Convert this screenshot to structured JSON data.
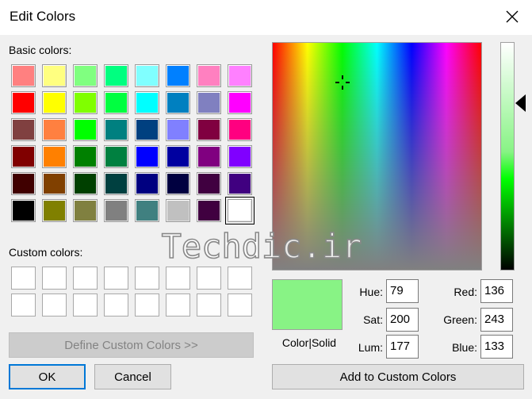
{
  "window": {
    "title": "Edit Colors",
    "close_icon": "close-icon"
  },
  "basic_colors": {
    "label": "Basic colors:",
    "rows": [
      [
        "#ff8080",
        "#ffff80",
        "#80ff80",
        "#00ff80",
        "#80ffff",
        "#0080ff",
        "#ff80c0",
        "#ff80ff"
      ],
      [
        "#ff0000",
        "#ffff00",
        "#80ff00",
        "#00ff40",
        "#00ffff",
        "#0080c0",
        "#8080c0",
        "#ff00ff"
      ],
      [
        "#804040",
        "#ff8040",
        "#00ff00",
        "#008080",
        "#004080",
        "#8080ff",
        "#800040",
        "#ff0080"
      ],
      [
        "#800000",
        "#ff8000",
        "#008000",
        "#008040",
        "#0000ff",
        "#0000a0",
        "#800080",
        "#8000ff"
      ],
      [
        "#400000",
        "#804000",
        "#004000",
        "#004040",
        "#000080",
        "#000040",
        "#400040",
        "#400080"
      ],
      [
        "#000000",
        "#808000",
        "#808040",
        "#808080",
        "#408080",
        "#c0c0c0",
        "#400040",
        "#ffffff"
      ]
    ],
    "selected": [
      5,
      7
    ]
  },
  "custom_colors": {
    "label": "Custom colors:",
    "rows": 2,
    "cols": 8
  },
  "buttons": {
    "define": "Define Custom Colors >>",
    "ok": "OK",
    "cancel": "Cancel",
    "add": "Add to Custom Colors"
  },
  "preview": {
    "label": "Color|Solid",
    "color": "#88f385"
  },
  "fields": {
    "hue": {
      "label": "Hue:",
      "value": "79"
    },
    "sat": {
      "label": "Sat:",
      "value": "200"
    },
    "lum": {
      "label": "Lum:",
      "value": "177"
    },
    "red": {
      "label": "Red:",
      "value": "136"
    },
    "green": {
      "label": "Green:",
      "value": "243"
    },
    "blue": {
      "label": "Blue:",
      "value": "133"
    }
  },
  "watermark": {
    "text": "Techdic.ir"
  }
}
